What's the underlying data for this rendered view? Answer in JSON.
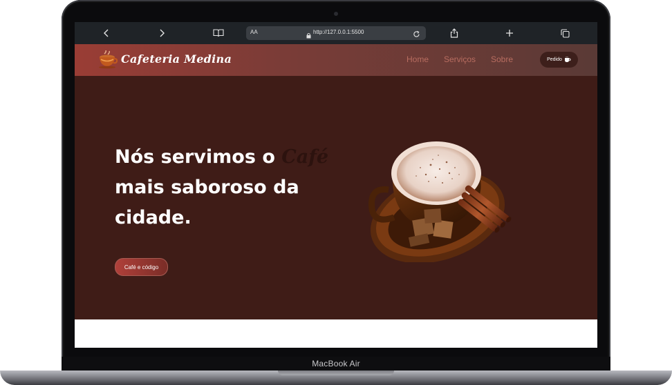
{
  "device": {
    "label": "MacBook Air"
  },
  "browser": {
    "text_size_label": "AA",
    "url": "http://127.0.0.1:5500",
    "icons": [
      "back-icon",
      "forward-icon",
      "bookmarks-icon",
      "lock-icon",
      "reload-icon",
      "share-icon",
      "new-tab-icon",
      "tabs-icon"
    ]
  },
  "site": {
    "brand": "Cafeteria Medina",
    "nav": [
      "Home",
      "Serviços",
      "Sobre"
    ],
    "order_button": "Pedido",
    "hero": {
      "line1_prefix": "Nós servimos o ",
      "line1_accent": "Café",
      "line2": "mais saboroso da",
      "line3": "cidade.",
      "cta": "Café e código"
    },
    "colors": {
      "nav_gradient_start": "#9a3d35",
      "hero_background": "#3f1c17",
      "nav_link": "#b86d60",
      "accent_text": "#2c120e"
    }
  }
}
